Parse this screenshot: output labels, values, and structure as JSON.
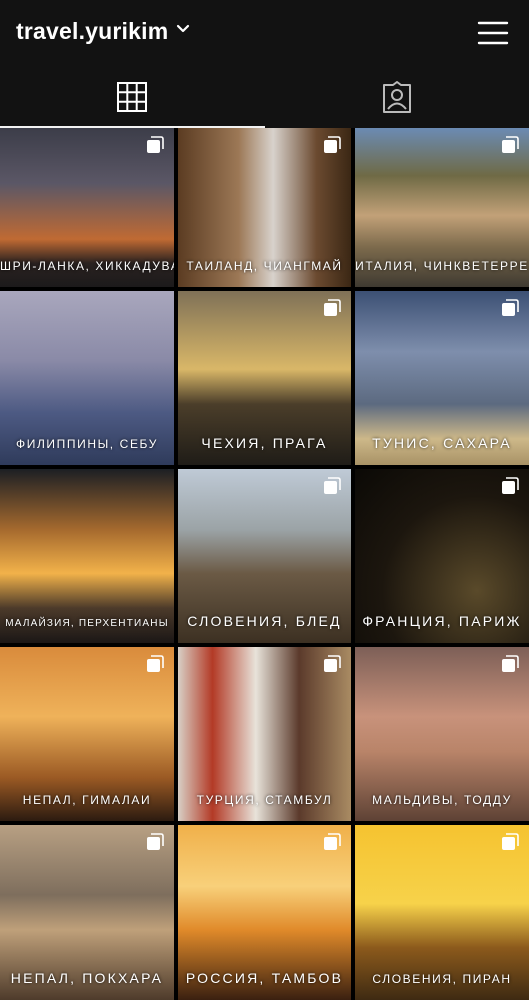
{
  "header": {
    "username": "travel.yurikim",
    "dropdown_icon": "chevron-down-icon",
    "menu_icon": "hamburger-menu-icon"
  },
  "tabs": [
    {
      "name": "grid",
      "icon": "grid-icon",
      "active": true
    },
    {
      "name": "tagged",
      "icon": "tagged-person-icon",
      "active": false
    }
  ],
  "colors": {
    "background": "#000000",
    "bar": "#121212",
    "text": "#ffffff"
  },
  "posts": [
    {
      "caption": "ШРИ-ЛАНКА, ХИККАДУВА",
      "multiple": true
    },
    {
      "caption": "ТАИЛАНД, ЧИАНГМАЙ",
      "multiple": true
    },
    {
      "caption": "ИТАЛИЯ, ЧИНКВЕТЕРРЕ",
      "multiple": true
    },
    {
      "caption": "ФИЛИППИНЫ, СЕБУ",
      "multiple": false
    },
    {
      "caption": "ЧЕХИЯ, ПРАГА",
      "multiple": true
    },
    {
      "caption": "ТУНИС, САХАРА",
      "multiple": true
    },
    {
      "caption": "МАЛАЙЗИЯ, ПЕРХЕНТИАНЫ",
      "multiple": false
    },
    {
      "caption": "СЛОВЕНИЯ, БЛЕД",
      "multiple": true
    },
    {
      "caption": "ФРАНЦИЯ, ПАРИЖ",
      "multiple": true
    },
    {
      "caption": "НЕПАЛ, ГИМАЛАИ",
      "multiple": true
    },
    {
      "caption": "ТУРЦИЯ, СТАМБУЛ",
      "multiple": true
    },
    {
      "caption": "МАЛЬДИВЫ, ТОДДУ",
      "multiple": true
    },
    {
      "caption": "НЕПАЛ, ПОКХАРА",
      "multiple": true
    },
    {
      "caption": "РОССИЯ, ТАМБОВ",
      "multiple": true
    },
    {
      "caption": "СЛОВЕНИЯ, ПИРАН",
      "multiple": true
    }
  ]
}
